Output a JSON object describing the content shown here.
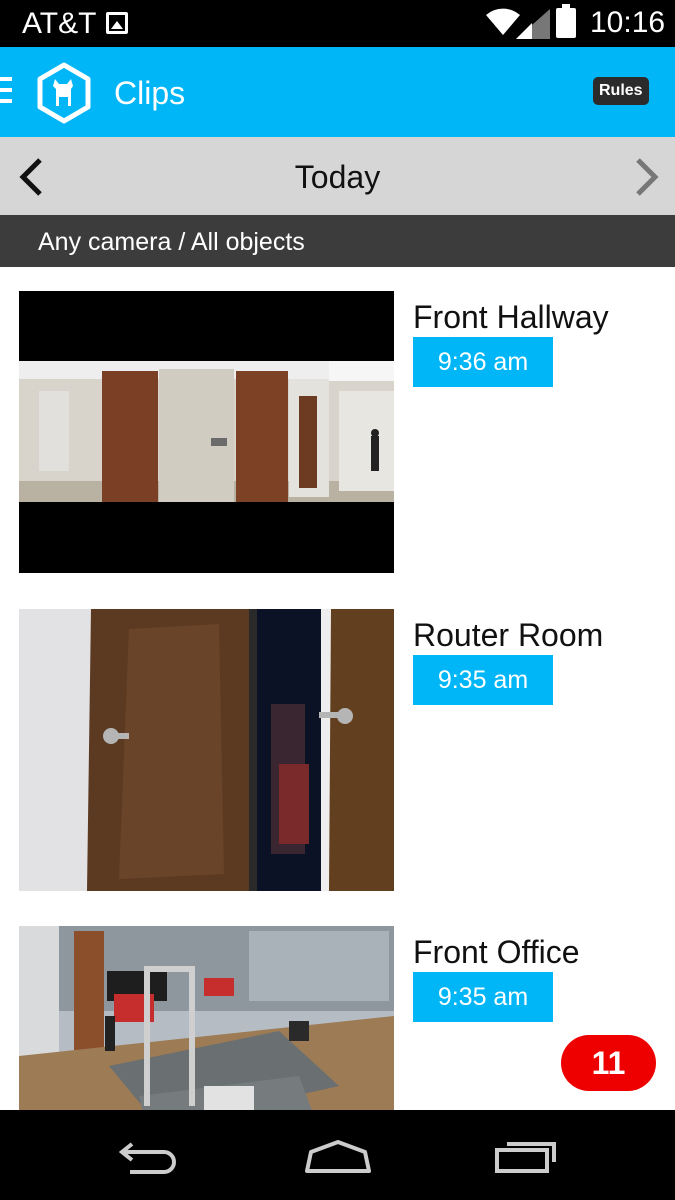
{
  "status_bar": {
    "carrier": "AT&T",
    "time": "10:16",
    "icons": [
      "gallery-icon",
      "wifi-icon",
      "signal-icon",
      "battery-icon"
    ]
  },
  "app_bar": {
    "title": "Clips",
    "rules_label": "Rules",
    "icons": [
      "menu-icon",
      "dog-logo-icon"
    ]
  },
  "date_nav": {
    "label": "Today",
    "icons": [
      "chevron-left-icon",
      "chevron-right-icon"
    ]
  },
  "filter": {
    "label": "Any camera / All objects"
  },
  "clips": [
    {
      "camera": "Front Hallway",
      "time": "9:36 am"
    },
    {
      "camera": "Router Room",
      "time": "9:35 am"
    },
    {
      "camera": "Front Office",
      "time": "9:35 am"
    }
  ],
  "badge": {
    "count": "11"
  },
  "colors": {
    "accent": "#00b6f6",
    "badge": "#ee0000",
    "date_bar": "#d6d6d6",
    "filter_bar": "#3c3c3c"
  },
  "nav_bar": {
    "icons": [
      "back-icon",
      "home-icon",
      "recents-icon"
    ]
  }
}
